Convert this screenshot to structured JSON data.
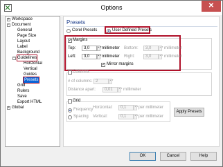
{
  "window": {
    "title": "Options"
  },
  "tree": {
    "workspace": "Workspace",
    "document": "Document",
    "general": "General",
    "page_size": "Page Size",
    "layout": "Layout",
    "label": "Label",
    "background": "Background",
    "guidelines": "Guidelines",
    "horizontal": "Horizontal",
    "vertical": "Vertical",
    "guides": "Guides",
    "presets": "Presets",
    "grid": "Grid",
    "rulers": "Rulers",
    "save": "Save",
    "export_html": "Export HTML",
    "global": "Global"
  },
  "panel": {
    "heading": "Presets",
    "corel_presets": "Corel Presets",
    "user_defined_presets": "User Defined Presets",
    "margins": {
      "label": "Margins",
      "top_label": "Top:",
      "top_value": "3,0",
      "top_unit": "millimeter",
      "left_label": "Left:",
      "left_value": "3,0",
      "left_unit": "millimeter",
      "bottom_label": "Bottom:",
      "bottom_value": "3,0",
      "bottom_unit": "millimeter",
      "right_label": "Right:",
      "right_value": "3,0",
      "right_unit": "millimeter",
      "mirror_label": "Mirror margins"
    },
    "columns": {
      "label": "Columns",
      "num_label": "# of columns:",
      "num_value": "2",
      "distance_label": "Distance apart:",
      "distance_value": "0,01",
      "distance_unit": "millimeter"
    },
    "apply_presets": "Apply Presets",
    "grid": {
      "label": "Grid",
      "frequency": "Frequency",
      "spacing": "Spacing",
      "horizontal_label": "Horizontal:",
      "horizontal_value": "0,1",
      "horizontal_unit": "per millimeter",
      "vertical_label": "Vertical:",
      "vertical_value": "0,1",
      "vertical_unit": "per millimeter"
    }
  },
  "buttons": {
    "ok": "OK",
    "cancel": "Cancel",
    "help": "Help"
  }
}
